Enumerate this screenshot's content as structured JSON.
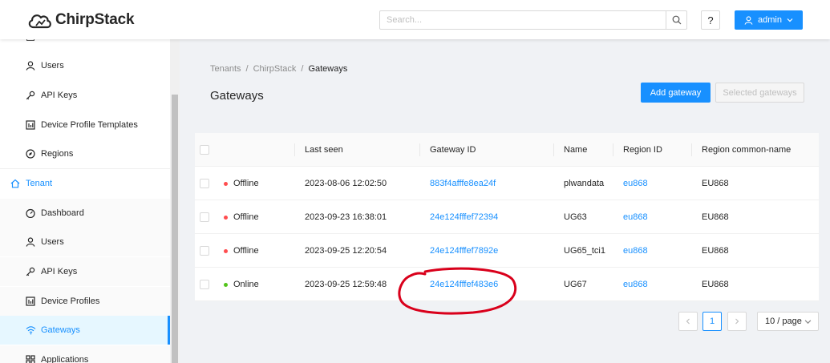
{
  "header": {
    "logo_text": "ChirpStack",
    "search_placeholder": "Search...",
    "help_label": "?",
    "user_label": "admin"
  },
  "sidebar": {
    "items": [
      {
        "label": "Users",
        "icon": "user-icon"
      },
      {
        "label": "API Keys",
        "icon": "key-icon"
      },
      {
        "label": "Device Profile Templates",
        "icon": "template-icon"
      },
      {
        "label": "Regions",
        "icon": "compass-icon"
      },
      {
        "label": "Tenant",
        "icon": "home-icon"
      },
      {
        "label": "Dashboard",
        "icon": "dashboard-icon"
      },
      {
        "label": "Users",
        "icon": "user-icon"
      },
      {
        "label": "API Keys",
        "icon": "key-icon"
      },
      {
        "label": "Device Profiles",
        "icon": "template-icon"
      },
      {
        "label": "Gateways",
        "icon": "wifi-icon"
      },
      {
        "label": "Applications",
        "icon": "apps-icon"
      }
    ]
  },
  "breadcrumb": {
    "items": [
      "Tenants",
      "ChirpStack",
      "Gateways"
    ]
  },
  "page": {
    "title": "Gateways",
    "add_button": "Add gateway",
    "selected_button": "Selected gateways"
  },
  "table": {
    "columns": [
      "",
      "Last seen",
      "Gateway ID",
      "Name",
      "Region ID",
      "Region common-name"
    ],
    "rows": [
      {
        "status": "Offline",
        "last_seen": "2023-08-06 12:02:50",
        "gateway_id": "883f4afffe8ea24f",
        "name": "plwandata",
        "region_id": "eu868",
        "region_name": "EU868"
      },
      {
        "status": "Offline",
        "last_seen": "2023-09-23 16:38:01",
        "gateway_id": "24e124fffef72394",
        "name": "UG63",
        "region_id": "eu868",
        "region_name": "EU868"
      },
      {
        "status": "Offline",
        "last_seen": "2023-09-25 12:20:54",
        "gateway_id": "24e124fffef7892e",
        "name": "UG65_tci1",
        "region_id": "eu868",
        "region_name": "EU868"
      },
      {
        "status": "Online",
        "last_seen": "2023-09-25 12:59:48",
        "gateway_id": "24e124fffef483e6",
        "name": "UG67",
        "region_id": "eu868",
        "region_name": "EU868"
      }
    ]
  },
  "pagination": {
    "current_page": "1",
    "page_size": "10 / page"
  },
  "colors": {
    "primary": "#1890ff",
    "offline": "#ff4d4f",
    "online": "#52c41a",
    "annotation": "#d9001b"
  }
}
